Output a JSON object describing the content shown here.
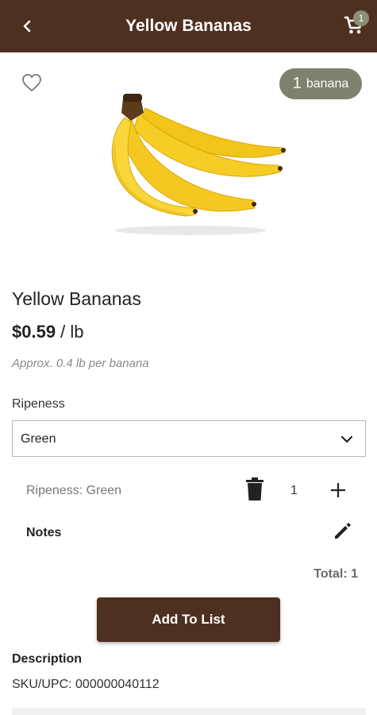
{
  "app_bar": {
    "title": "Yellow Bananas",
    "cart_count": "1",
    "background_color": "#4e3020"
  },
  "product": {
    "unit_count": "1",
    "unit_label": "banana",
    "name": "Yellow Bananas",
    "price": "$0.59",
    "price_unit": " / lb",
    "approx_weight": "Approx. 0.4 lb per banana",
    "image_icon": "banana-bunch"
  },
  "ripeness": {
    "label": "Ripeness",
    "selected": "Green"
  },
  "line_item": {
    "variant": "Ripeness: Green",
    "quantity": "1",
    "notes_label": "Notes",
    "total": "Total: 1"
  },
  "actions": {
    "add_to_list": "Add To List"
  },
  "description": {
    "label": "Description",
    "sku": "SKU/UPC: 000000040112"
  },
  "icons": [
    "back-arrow",
    "cart",
    "heart-outline",
    "chevron-down",
    "trash",
    "plus",
    "pencil"
  ]
}
